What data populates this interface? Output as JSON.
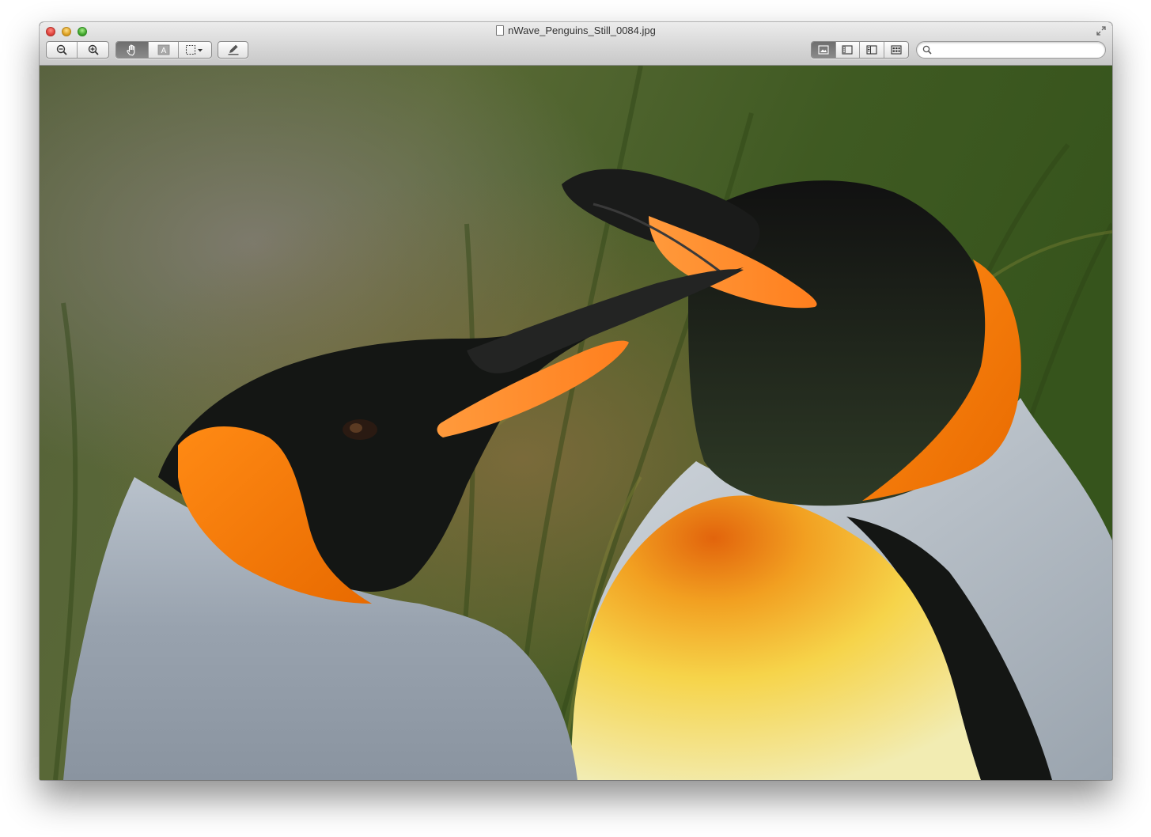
{
  "window": {
    "title": "nWave_Penguins_Still_0084.jpg"
  },
  "toolbar": {
    "zoom_out_icon": "zoom-out-icon",
    "zoom_in_icon": "zoom-in-icon",
    "move_tool_icon": "hand-icon",
    "text_tool_icon": "text-select-icon",
    "selection_tool_icon": "rect-select-icon",
    "annotate_icon": "pencil-icon",
    "active_tool": "move",
    "view_modes": [
      "content-only",
      "thumbnails",
      "table-of-contents",
      "contact-sheet"
    ],
    "active_view_mode": "content-only"
  },
  "search": {
    "placeholder": "",
    "value": ""
  },
  "image": {
    "subject": "two king penguins",
    "colors": {
      "background": "#4a5a2a",
      "beak_orange": "#ff8c2a",
      "head_black": "#151815"
    }
  }
}
